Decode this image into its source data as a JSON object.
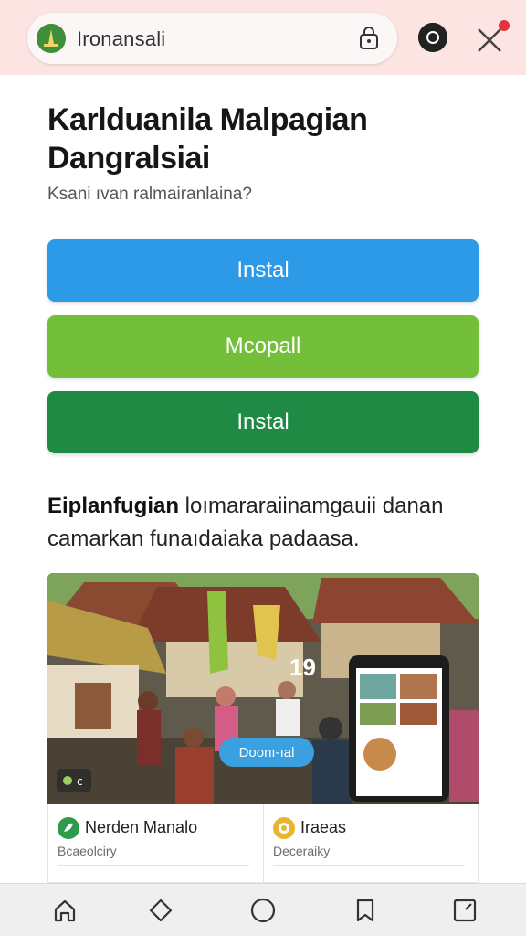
{
  "browser": {
    "url_text": "Ironansali",
    "icons": [
      "site-logo-icon",
      "lock-icon",
      "account-icon",
      "close-icon"
    ]
  },
  "page": {
    "title": "Karlduanila Malpagian Dangralsiai",
    "subtitle": "Ksani ıvan ralmairanlaina?"
  },
  "buttons": {
    "primary_label": "Instal",
    "secondary_label": "Mcopall",
    "tertiary_label": "Instal"
  },
  "description": {
    "bold": "Eiplanfugian",
    "rest": " loımararaiinamgauii danan camarkan funaıdaiaka padaasa."
  },
  "hero": {
    "download_label": "Dоonı-ıal",
    "number": "19"
  },
  "cards": [
    {
      "title": "Nerden Manalo",
      "subtitle": "Bcaeolciry",
      "icon": "leaf-icon"
    },
    {
      "title": "Iraeas",
      "subtitle": "Deceraiky",
      "icon": "emblem-icon"
    }
  ],
  "bottom_nav": [
    "home-icon",
    "tag-icon",
    "circle-icon",
    "bookmark-icon",
    "tabs-icon"
  ],
  "colors": {
    "topbar": "#fbe4e2",
    "btn_blue": "#2d9ae8",
    "btn_lime": "#73bf3a",
    "btn_green": "#1f8a44"
  }
}
